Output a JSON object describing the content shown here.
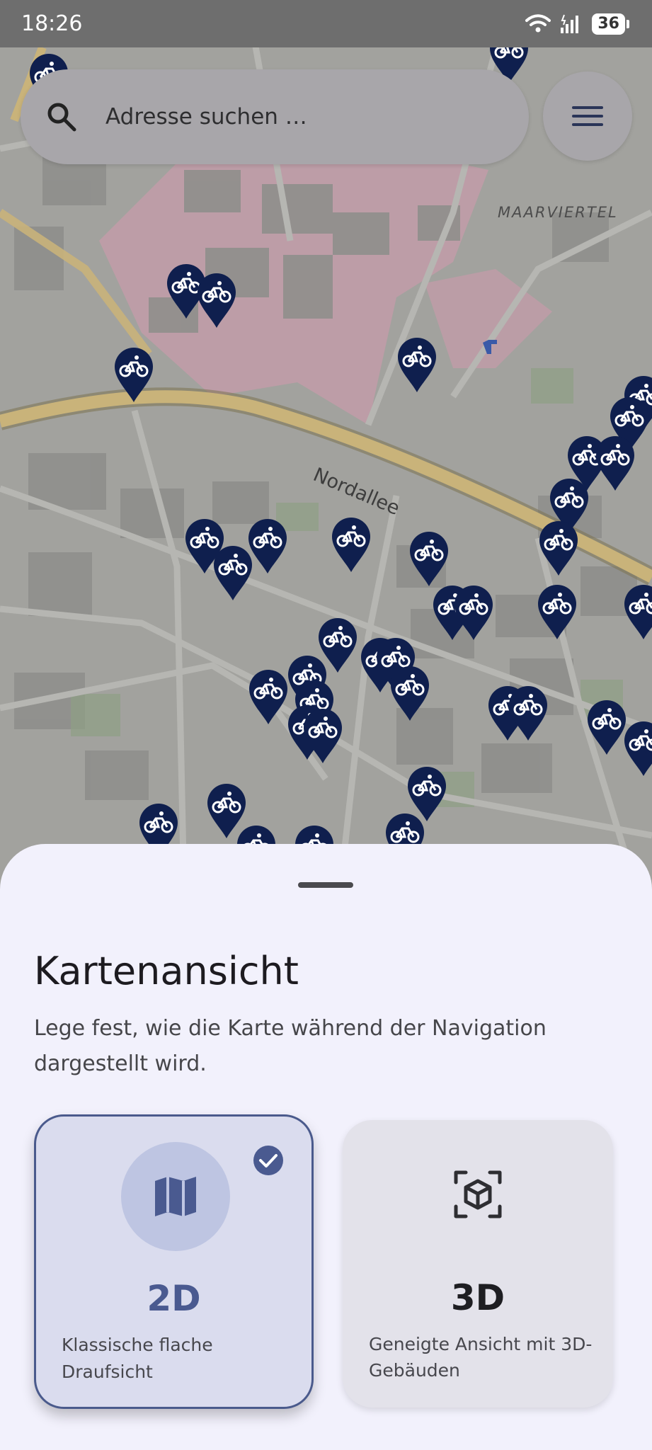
{
  "status_bar": {
    "time": "18:26",
    "battery": "36"
  },
  "search": {
    "placeholder": "Adresse suchen …"
  },
  "map": {
    "street_label": "Nordallee",
    "district_label": "MAARVIERTEL",
    "pin_icon": "bicycle-icon",
    "pin_color": "#0f1f4e",
    "road_color": "#c9b37a",
    "zone_color": "#c79aa8"
  },
  "sheet": {
    "title": "Kartenansicht",
    "description": "Lege fest, wie die Karte während der Navigation dargestellt wird.",
    "options": [
      {
        "id": "2d",
        "label": "2D",
        "description": "Klassische flache Draufsicht",
        "selected": true,
        "icon": "map-icon"
      },
      {
        "id": "3d",
        "label": "3D",
        "description": "Geneigte Ansicht mit 3D-Gebäuden",
        "selected": false,
        "icon": "cube-icon"
      }
    ]
  },
  "colors": {
    "accent": "#4a5a90",
    "sheet_bg": "#f2f1fc",
    "selected_card_bg": "#dadcee"
  }
}
